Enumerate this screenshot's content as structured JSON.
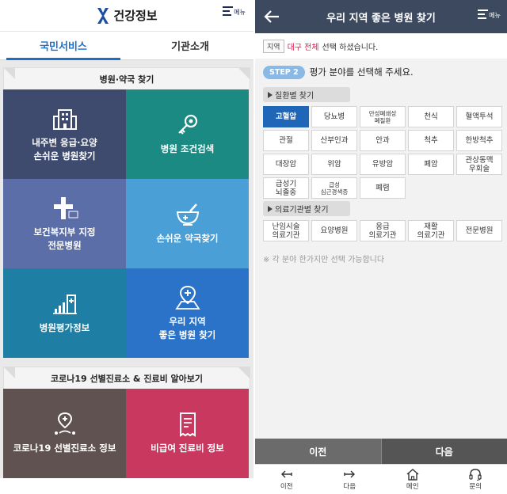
{
  "left": {
    "app_title": "건강정보",
    "menu_label": "메뉴",
    "tabs": [
      {
        "label": "국민서비스"
      },
      {
        "label": "기관소개"
      }
    ],
    "section1": {
      "title": "병원·약국 찾기",
      "tiles": [
        {
          "label": "내주변 응급·요양\n손쉬운 병원찾기",
          "color": "#3e4a6e",
          "icon": "hospital-building-icon"
        },
        {
          "label": "병원 조건검색",
          "color": "#1a8a82",
          "icon": "key-search-icon"
        },
        {
          "label": "보건복지부 지정\n전문병원",
          "color": "#5c6ea8",
          "icon": "specialty-hospital-icon"
        },
        {
          "label": "손쉬운 약국찾기",
          "color": "#4a9fd6",
          "icon": "mortar-pestle-icon"
        },
        {
          "label": "병원평가정보",
          "color": "#1e7ea3",
          "icon": "evaluation-chart-icon"
        },
        {
          "label": "우리 지역\n좋은 병원 찾기",
          "color": "#2a73c9",
          "icon": "map-pin-icon"
        }
      ]
    },
    "section2": {
      "title": "코로나19 선별진료소 & 진료비 알아보기",
      "tiles": [
        {
          "label": "코로나19 선별진료소 정보",
          "color": "#5f5250",
          "icon": "clinic-pin-icon"
        },
        {
          "label": "비급여 진료비 정보",
          "color": "#c9395f",
          "icon": "receipt-icon"
        }
      ]
    }
  },
  "right": {
    "title": "우리 지역 좋은 병원 찾기",
    "menu_label": "메뉴",
    "region_tag": "지역",
    "region_value": "대구 전체",
    "region_suffix": "선택 하셨습니다.",
    "step_badge": "STEP 2",
    "step_text": "평가 분야를 선택해 주세요.",
    "cat1_label": "질환별 찾기",
    "cat1_options": [
      {
        "label": "고혈압",
        "selected": true,
        "small": false
      },
      {
        "label": "당뇨병",
        "selected": false,
        "small": false
      },
      {
        "label": "만성폐쇄성\n폐질환",
        "selected": false,
        "small": true
      },
      {
        "label": "천식",
        "selected": false,
        "small": false
      },
      {
        "label": "혈액투석",
        "selected": false,
        "small": false
      },
      {
        "label": "관절",
        "selected": false,
        "small": false
      },
      {
        "label": "산부인과",
        "selected": false,
        "small": false
      },
      {
        "label": "안과",
        "selected": false,
        "small": false
      },
      {
        "label": "척추",
        "selected": false,
        "small": false
      },
      {
        "label": "한방척추",
        "selected": false,
        "small": false
      },
      {
        "label": "대장암",
        "selected": false,
        "small": false
      },
      {
        "label": "위암",
        "selected": false,
        "small": false
      },
      {
        "label": "유방암",
        "selected": false,
        "small": false
      },
      {
        "label": "폐암",
        "selected": false,
        "small": false
      },
      {
        "label": "관상동맥\n우회술",
        "selected": false,
        "small": false
      },
      {
        "label": "급성기\n뇌졸중",
        "selected": false,
        "small": false
      },
      {
        "label": "급성\n심근경색증",
        "selected": false,
        "small": true
      },
      {
        "label": "폐렴",
        "selected": false,
        "small": false
      }
    ],
    "cat2_label": "의료기관별 찾기",
    "cat2_options": [
      {
        "label": "난임시술\n의료기관",
        "selected": false,
        "small": false
      },
      {
        "label": "요양병원",
        "selected": false,
        "small": false
      },
      {
        "label": "응급\n의료기관",
        "selected": false,
        "small": false
      },
      {
        "label": "재활\n의료기관",
        "selected": false,
        "small": false
      },
      {
        "label": "전문병원",
        "selected": false,
        "small": false
      }
    ],
    "note": "※ 각 분야 한가지만 선택 가능합니다",
    "prev_label": "이전",
    "next_label": "다음",
    "nav": [
      {
        "label": "이전",
        "icon": "arrow-left-icon"
      },
      {
        "label": "다음",
        "icon": "arrow-right-icon"
      },
      {
        "label": "메인",
        "icon": "home-icon"
      },
      {
        "label": "문의",
        "icon": "headset-icon"
      }
    ]
  }
}
